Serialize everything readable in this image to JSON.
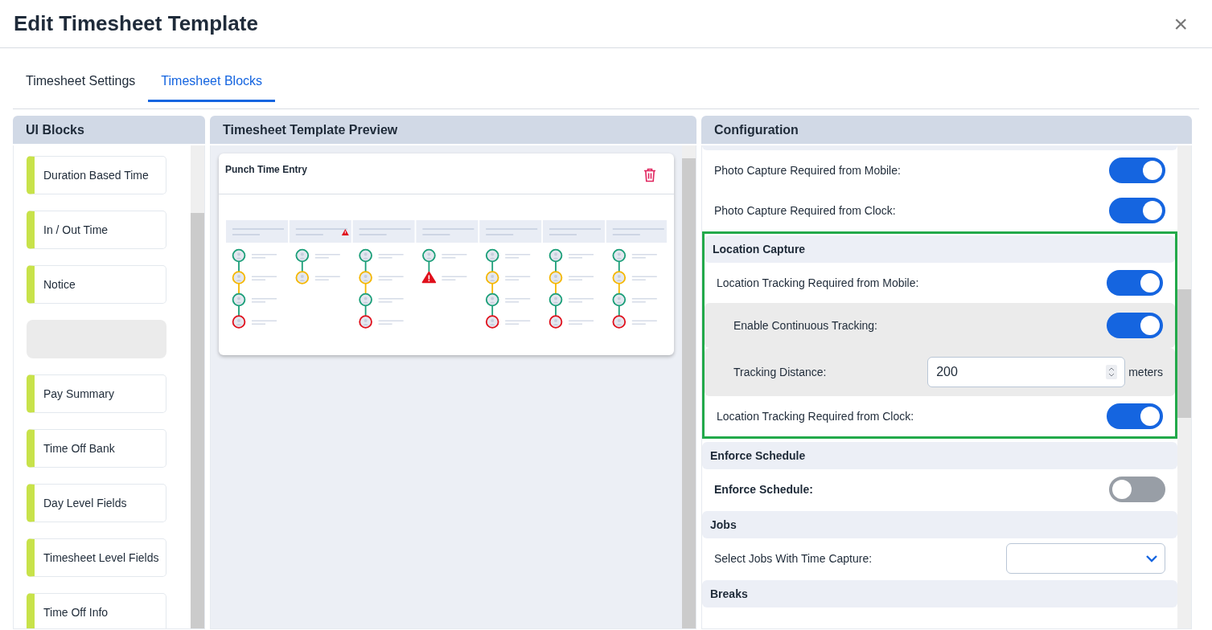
{
  "dialog": {
    "title": "Edit Timesheet Template",
    "close": "×"
  },
  "tabs": [
    {
      "label": "Timesheet Settings",
      "selected": false
    },
    {
      "label": "Timesheet Blocks",
      "selected": true
    }
  ],
  "ui_blocks": {
    "title": "UI Blocks",
    "items": [
      {
        "kind": "block",
        "label": "Duration Based Time"
      },
      {
        "kind": "block",
        "label": "In / Out Time"
      },
      {
        "kind": "block",
        "label": "Notice"
      },
      {
        "kind": "placeholder"
      },
      {
        "kind": "block",
        "label": "Pay Summary"
      },
      {
        "kind": "block",
        "label": "Time Off Bank"
      },
      {
        "kind": "block",
        "label": "Day Level Fields"
      },
      {
        "kind": "block",
        "label": "Timesheet Level Fields"
      },
      {
        "kind": "block",
        "label": "Time Off Info"
      }
    ]
  },
  "preview": {
    "title": "Timesheet Template Preview",
    "card": {
      "title": "Punch Time Entry",
      "columns": [
        {
          "warning": false,
          "punches": [
            {
              "kind": "in"
            },
            {
              "kind": "break"
            },
            {
              "kind": "in"
            },
            {
              "kind": "out"
            }
          ]
        },
        {
          "warning": true,
          "punches": [
            {
              "kind": "in"
            },
            {
              "kind": "break"
            }
          ]
        },
        {
          "warning": false,
          "punches": [
            {
              "kind": "in"
            },
            {
              "kind": "break"
            },
            {
              "kind": "in"
            },
            {
              "kind": "out"
            }
          ]
        },
        {
          "warning": false,
          "punches": [
            {
              "kind": "in"
            },
            {
              "kind": "error"
            }
          ]
        },
        {
          "warning": false,
          "punches": [
            {
              "kind": "in"
            },
            {
              "kind": "break"
            },
            {
              "kind": "in"
            },
            {
              "kind": "out"
            }
          ]
        },
        {
          "warning": false,
          "punches": [
            {
              "kind": "in"
            },
            {
              "kind": "break"
            },
            {
              "kind": "in"
            },
            {
              "kind": "out"
            }
          ]
        },
        {
          "warning": false,
          "punches": [
            {
              "kind": "in"
            },
            {
              "kind": "break"
            },
            {
              "kind": "in"
            },
            {
              "kind": "out"
            }
          ]
        }
      ]
    }
  },
  "configuration": {
    "title": "Configuration",
    "groups": [
      {
        "highlighted": false,
        "rows": [
          {
            "kind": "toggle",
            "label": "Photo Capture Required from Mobile:",
            "on": true,
            "nested": false,
            "bold": false
          },
          {
            "kind": "toggle",
            "label": "Photo Capture Required from Clock:",
            "on": true,
            "nested": false,
            "bold": false
          }
        ]
      },
      {
        "title": "Location Capture",
        "highlighted": true,
        "rows": [
          {
            "kind": "toggle",
            "label": "Location Tracking Required from Mobile:",
            "on": true,
            "nested": false,
            "bold": false
          },
          {
            "kind": "toggle",
            "label": "Enable Continuous Tracking:",
            "on": true,
            "nested": true,
            "bold": false
          },
          {
            "kind": "number",
            "label": "Tracking Distance:",
            "value": "200",
            "unit": "meters",
            "nested": true,
            "bold": false
          },
          {
            "kind": "toggle",
            "label": "Location Tracking Required from Clock:",
            "on": true,
            "nested": false,
            "bold": false
          }
        ]
      },
      {
        "title": "Enforce Schedule",
        "highlighted": false,
        "rows": [
          {
            "kind": "toggle",
            "label": "Enforce Schedule:",
            "on": false,
            "nested": false,
            "bold": true
          }
        ]
      },
      {
        "title": "Jobs",
        "highlighted": false,
        "rows": [
          {
            "kind": "select",
            "label": "Select Jobs With Time Capture:",
            "nested": false,
            "bold": false
          }
        ]
      },
      {
        "title": "Breaks",
        "highlighted": false
      }
    ]
  }
}
